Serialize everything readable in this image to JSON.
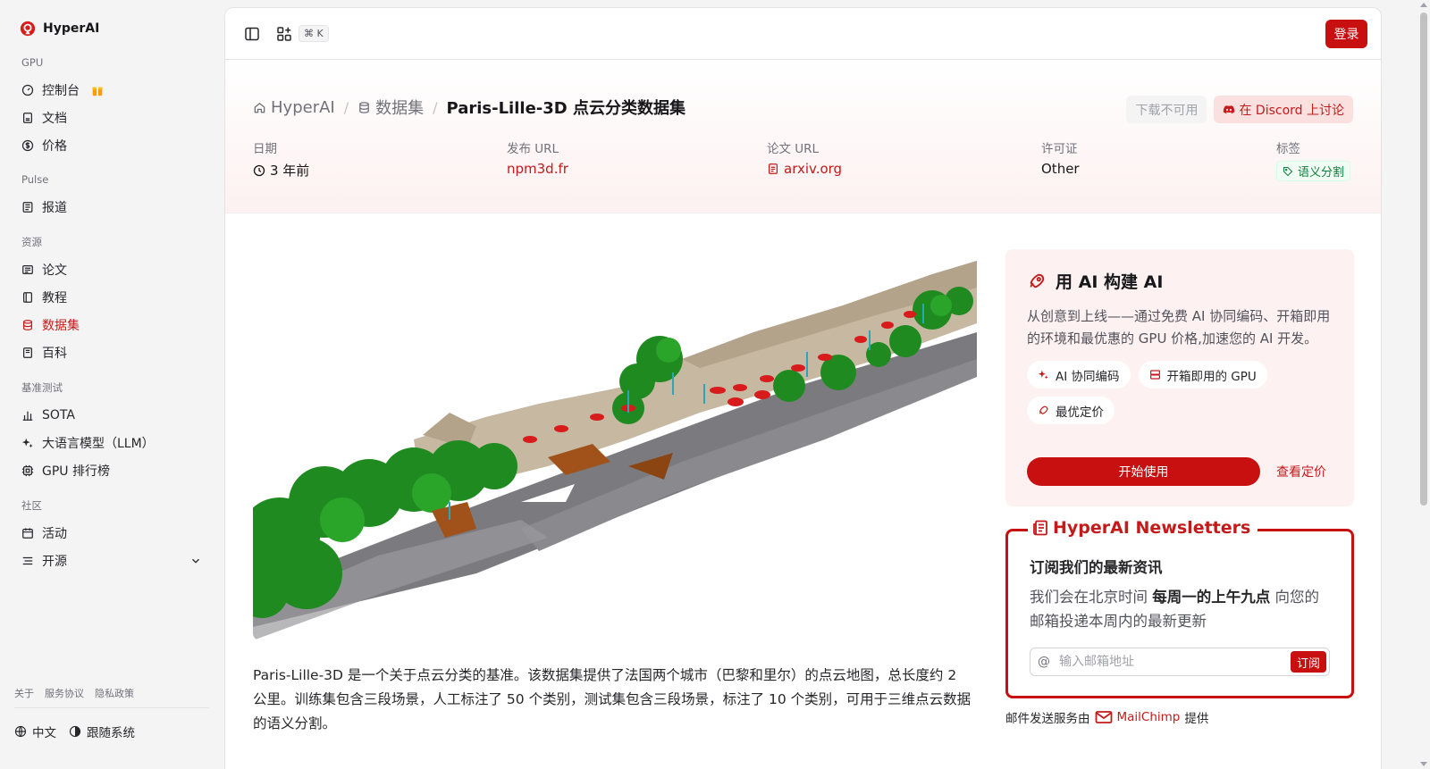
{
  "brand": {
    "name": "HyperAI"
  },
  "sidebar": {
    "sections": {
      "gpu": "GPU",
      "pulse": "Pulse",
      "resources": "资源",
      "benchmarks": "基准测试",
      "community": "社区"
    },
    "items": {
      "console": "控制台",
      "docs": "文档",
      "pricing": "价格",
      "news": "报道",
      "papers": "论文",
      "tutorials": "教程",
      "datasets": "数据集",
      "wiki": "百科",
      "sota": "SOTA",
      "llm": "大语言模型（LLM）",
      "gpu_leaderboard": "GPU 排行榜",
      "events": "活动",
      "open_source": "开源"
    },
    "active_item": "datasets",
    "footer_links": {
      "about": "关于",
      "terms": "服务协议",
      "privacy": "隐私政策"
    },
    "language": "中文",
    "theme": "跟随系统"
  },
  "topbar": {
    "shortcut": "⌘ K",
    "login": "登录"
  },
  "breadcrumb": {
    "home": "HyperAI",
    "section": "数据集",
    "current": "Paris-Lille-3D 点云分类数据集"
  },
  "actions": {
    "download": "下载不可用",
    "discord": "在 Discord 上讨论"
  },
  "meta": {
    "date_label": "日期",
    "date_value": "3 年前",
    "url_label": "发布 URL",
    "url_value": "npm3d.fr",
    "paper_label": "论文 URL",
    "paper_value": "arxiv.org",
    "license_label": "许可证",
    "license_value": "Other",
    "tags_label": "标签",
    "tag_value": "语义分割"
  },
  "description": "Paris-Lille-3D 是一个关于点云分类的基准。该数据集提供了法国两个城市（巴黎和里尔）的点云地图，总长度约 2 公里。训练集包含三段场景，人工标注了 50 个类别，测试集包含三段场景，标注了 10 个类别，可用于三维点云数据的语义分割。",
  "promo": {
    "title": "用 AI 构建 AI",
    "text": "从创意到上线——通过免费 AI 协同编码、开箱即用的环境和最优惠的 GPU 价格,加速您的 AI 开发。",
    "chips": {
      "cocode": "AI 协同编码",
      "gpu": "开箱即用的 GPU",
      "price": "最优定价"
    },
    "start": "开始使用",
    "pricing": "查看定价"
  },
  "newsletter": {
    "title": "HyperAI Newsletters",
    "heading": "订阅我们的最新资讯",
    "text_before": "我们会在北京时间 ",
    "text_bold": "每周一的上午九点",
    "text_after": " 向您的邮箱投递本周内的最新更新",
    "placeholder": "输入邮箱地址",
    "subscribe": "订阅",
    "service_prefix": "邮件发送服务由",
    "service_name": "MailChimp",
    "service_suffix": "提供"
  },
  "colors": {
    "accent": "#c81010",
    "accent_text": "#c41a1a",
    "tag_green": "#15803d"
  }
}
